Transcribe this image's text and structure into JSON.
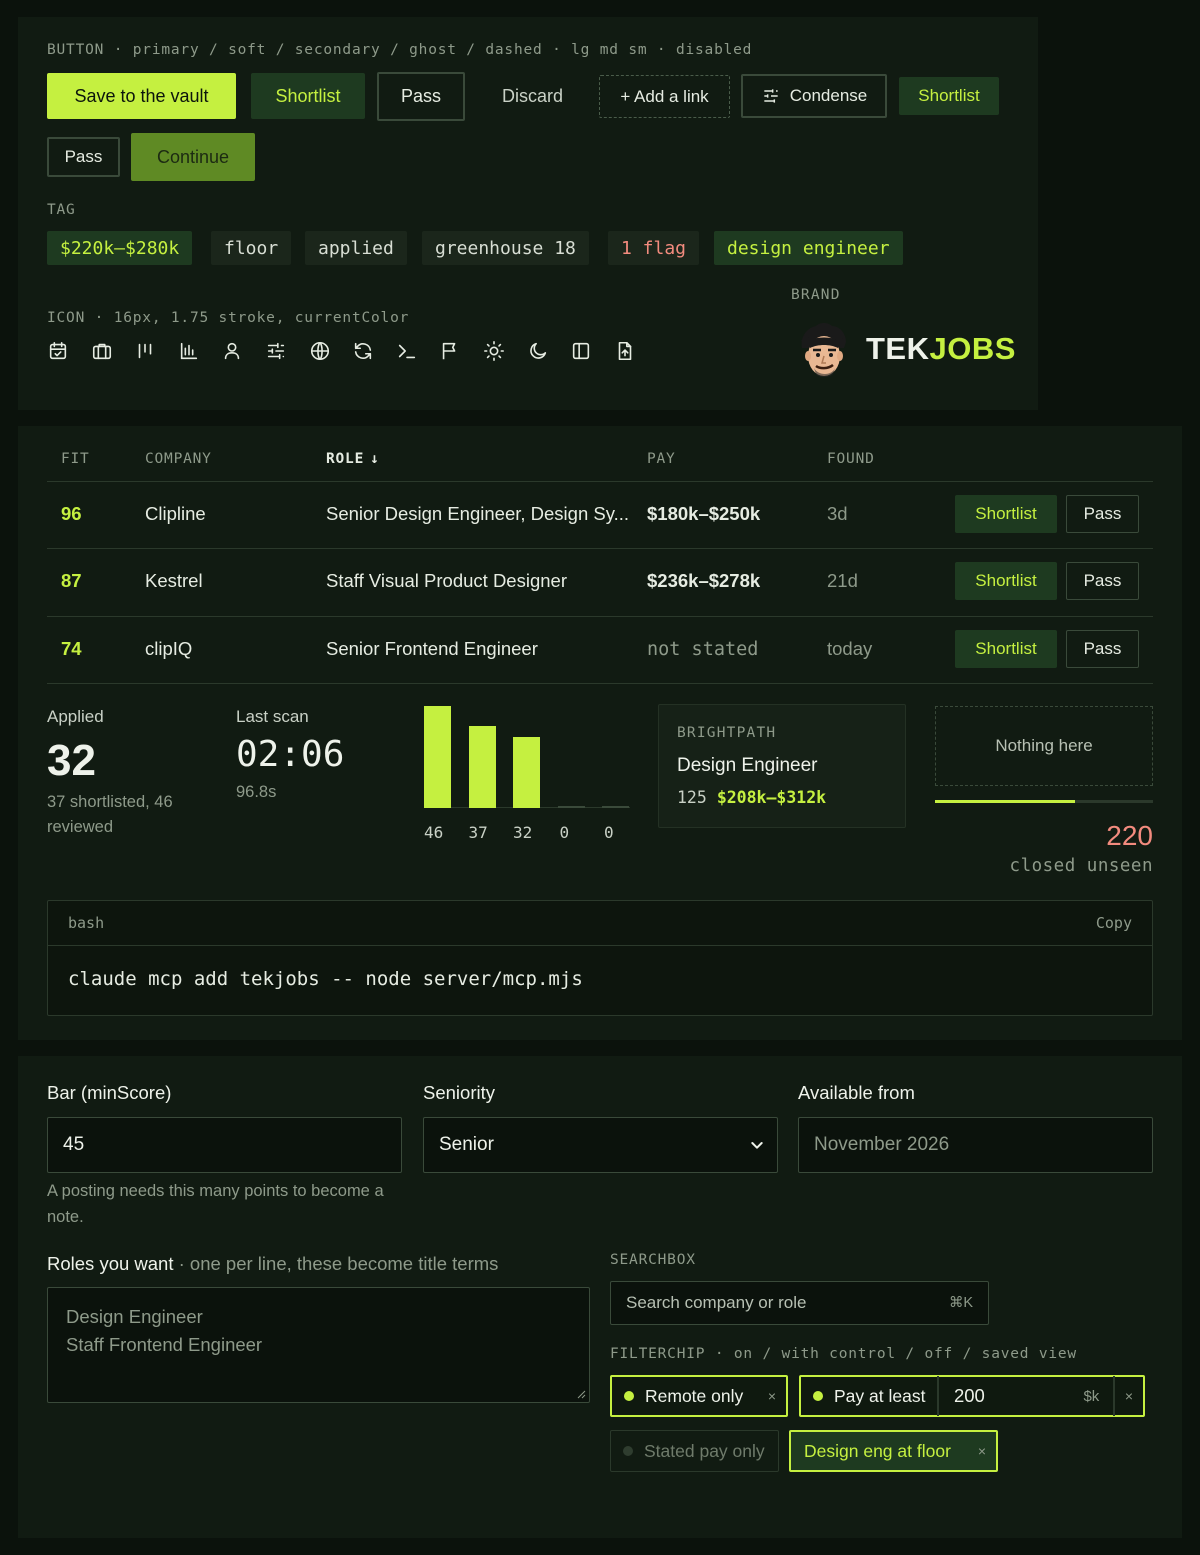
{
  "buttons": {
    "section_label": "BUTTON · primary / soft / secondary / ghost / dashed · lg md sm · disabled",
    "save": "Save to the vault",
    "shortlist_soft": "Shortlist",
    "pass_secondary": "Pass",
    "discard": "Discard",
    "add_link": "+ Add a link",
    "condense": "Condense",
    "shortlist_sm": "Shortlist",
    "pass_sm": "Pass",
    "continue_disabled": "Continue"
  },
  "tags": {
    "section_label": "TAG",
    "items": [
      "$220k–$280k",
      "floor",
      "applied",
      "greenhouse 18",
      "1 flag",
      "design engineer"
    ]
  },
  "icons": {
    "section_label": "ICON · 16px, 1.75 stroke, currentColor",
    "items": [
      "calendar-check-icon",
      "briefcase-icon",
      "columns-icon",
      "bar-chart-icon",
      "user-icon",
      "sliders-icon",
      "globe-icon",
      "refresh-icon",
      "terminal-icon",
      "flag-icon",
      "sun-icon",
      "moon-icon",
      "panel-icon",
      "file-upload-icon"
    ]
  },
  "brand": {
    "section_label": "BRAND",
    "word_part1": "TEK",
    "word_part2": "JOBS",
    "accent": "#c5f040"
  },
  "table": {
    "headers": {
      "fit": "FIT",
      "company": "COMPANY",
      "role": "ROLE",
      "pay": "PAY",
      "found": "FOUND"
    },
    "sort_indicator": "↓",
    "rows": [
      {
        "fit": "96",
        "company": "Clipline",
        "role": "Senior Design Engineer, Design Sy...",
        "pay": "$180k–$250k",
        "found": "3d",
        "shortlist": "Shortlist",
        "pass": "Pass"
      },
      {
        "fit": "87",
        "company": "Kestrel",
        "role": "Staff Visual Product Designer",
        "pay": "$236k–$278k",
        "found": "21d",
        "shortlist": "Shortlist",
        "pass": "Pass"
      },
      {
        "fit": "74",
        "company": "clipIQ",
        "role": "Senior Frontend Engineer",
        "pay": "not stated",
        "found": "today",
        "shortlist": "Shortlist",
        "pass": "Pass"
      }
    ]
  },
  "stats": {
    "applied_label": "Applied",
    "applied_value": "32",
    "applied_sub": "37 shortlisted, 46 reviewed",
    "scan_label": "Last scan",
    "scan_value": "02:06",
    "scan_sub": "96.8s"
  },
  "funnel": {
    "values": [
      46,
      37,
      32,
      0,
      0
    ],
    "labels": [
      "46",
      "37",
      "32",
      "0",
      "0"
    ]
  },
  "job_card": {
    "company": "BRIGHTPATH",
    "role": "Design Engineer",
    "count": "125",
    "pay": "$208k–$312k"
  },
  "empty_state": {
    "text": "Nothing here",
    "progress": 0.64
  },
  "counter": {
    "value": "220",
    "label": "closed unseen",
    "color": "#f28b7e"
  },
  "code_block": {
    "lang": "bash",
    "copy": "Copy",
    "command": "claude mcp add tekjobs -- node server/mcp.mjs"
  },
  "form": {
    "bar_label": "Bar (minScore)",
    "bar_value": "45",
    "bar_help": "A posting needs this many points to become a note.",
    "seniority_label": "Seniority",
    "seniority_value": "Senior",
    "available_label": "Available from",
    "available_placeholder": "November 2026",
    "roles_label": "Roles you want",
    "roles_hint": " · one per line, these become title terms",
    "roles_lines": [
      "Design Engineer",
      "Staff Frontend Engineer"
    ]
  },
  "searchbox": {
    "section_label": "SEARCHBOX",
    "placeholder": "Search company or role",
    "shortcut": "⌘K"
  },
  "filterchips": {
    "section_label": "FILTERCHIP · on / with control / off / saved view",
    "remote": "Remote only",
    "pay_label": "Pay at least",
    "pay_value": "200",
    "pay_unit": "$k",
    "stated": "Stated pay only",
    "saved": "Design eng at floor",
    "remove": "×"
  }
}
